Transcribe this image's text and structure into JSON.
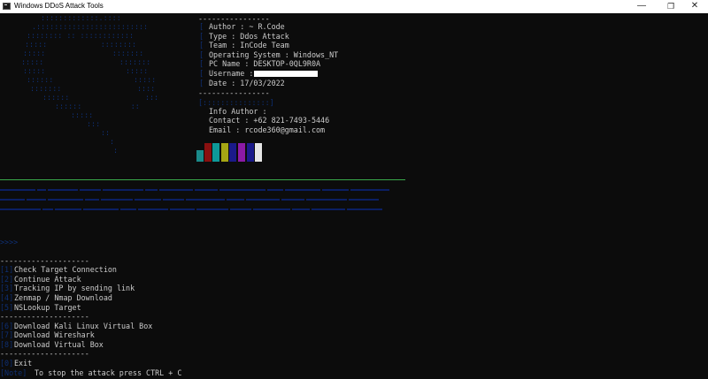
{
  "window": {
    "title": "Windows DDoS Attack Tools",
    "controls": [
      "—",
      "❐",
      "✕"
    ]
  },
  "info": {
    "separator": "----------------",
    "author": "Author : ~ R.Code",
    "type": "Type : Ddos Attack",
    "team": "Team : InCode Team",
    "os": "Operating System : Windows_NT",
    "pc_name": "PC Name : DESKTOP-0QL9R0A",
    "username_label": "Username : ",
    "date": "Date : 17/03/2022",
    "info_author": "Info Author :",
    "contact": "Contact : +62 821-7493-5446",
    "email": "Email : rcode360@gmail.com"
  },
  "swatches": [
    "#1a8a8a",
    "#8a1010",
    "#0f9999",
    "#a6a614",
    "#1a1a8a",
    "#8c1aa6",
    "#1a1a8a",
    "#e6e6e6"
  ],
  "menu": {
    "rule": "--------------------",
    "items": [
      "Check Target Connection",
      "Continue Attack",
      "Tracking IP by sending link",
      "Zenmap / Nmap Download",
      "NSLookup Target"
    ],
    "downloads": [
      "Download Kali Linux Virtual Box",
      "Download Wireshark",
      "Download Virtual Box"
    ],
    "exit": "Exit",
    "stop_hint": "To stop the attack press CTRL + C"
  }
}
